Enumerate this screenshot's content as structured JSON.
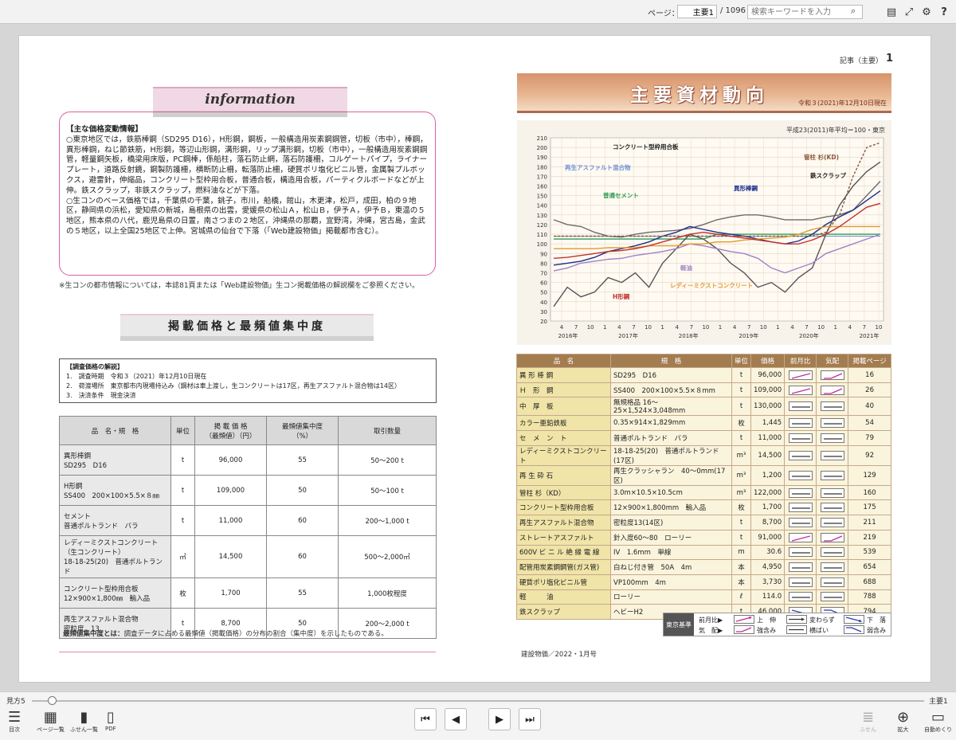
{
  "toolbar": {
    "page_label": "ページ：",
    "page_value": "主要1",
    "page_total": "/ 1096",
    "search_placeholder": "検索キーワードを入力"
  },
  "bottom": {
    "view_label": "見方5",
    "page_name": "主要1",
    "items": [
      "目次",
      "ページ一覧",
      "ふせん一覧",
      "PDF"
    ],
    "right_items": [
      "ふせん",
      "拡大",
      "自動めくり"
    ]
  },
  "right_page": {
    "kicker": "記事（主要）",
    "page_num": "1",
    "header_title": "主要資材動向",
    "header_date": "令和３(2021)年12月10日現在",
    "footer": "建設物価／2022・1月号"
  },
  "left_page": {
    "info_title": "information",
    "info_head": "【主な価格変動情報】",
    "info_p1": "○東京地区では，鉄筋棒鋼（SD295 D16），H形鋼，鋼板，一般構造用炭素鋼鋼管，切板（市中），棒鋼，異形棒鋼，ねじ節鉄筋，H形鋼，等辺山形鋼，溝形鋼，リップ溝形鋼，切板（市中），一般構造用炭素鋼鋼管，軽量鋼矢板，橋梁用床版，PC鋼棒，係船柱，落石防止網，落石防護柵，コルゲートパイプ，ライナープレート，道路反射鏡，鋼製防護柵，横断防止柵，転落防止柵，硬質ポリ塩化ビニル管，金属製プルボックス，避雷針，伸縮品，コンクリート型枠用合板，普通合板，構造用合板，パーティクルボードなどが上伸。鉄スクラップ，非鉄スクラップ，燃料油などが下落。",
    "info_p2": "○生コンのベース価格では，千葉県の千葉，銚子，市川，船橋，館山，木更津，松戸，成田，柏の９地区，静岡県の浜松，愛知県の新城，島根県の出雲，愛媛県の松山Ａ，松山Ｂ，伊予Ａ，伊予Ｂ，東温の５地区，熊本県の八代，鹿児島県の日置，南さつまの２地区，沖縄県の那覇，宜野湾，沖縄，宮古島，金武の５地区，以上全国25地区で上伸。宮城県の仙台で下落（「Web建設物価」掲載都市含む）。",
    "note1": "※生コンの都市情報については，本誌81頁または「Web建設物価」生コン掲載価格の解説欄をご参照ください。",
    "sec2_title": "掲載価格と最頻値集中度",
    "survey_head": "【調査価格の解説】",
    "survey": [
      "1.　調査時期　令和３（2021）年12月10日現在",
      "2.　荷渡場所　東京都市内現場持込み（鋼材は車上渡し，生コンクリートは17区，再生アスファルト混合物は14区）",
      "3.　決済条件　現金決済"
    ],
    "table_headers": [
      "品　名・規　格",
      "単位",
      "掲 載 価 格\n（最頻値）（円）",
      "最頻値集中度\n（%）",
      "取引数量"
    ],
    "table_rows": [
      [
        "異形棒鋼\nSD295　D16",
        "t",
        "96,000",
        "55",
        "50〜200 t"
      ],
      [
        "H形鋼\nSS400　200×100×5.5×８㎜",
        "t",
        "109,000",
        "50",
        "50〜100 t"
      ],
      [
        "セメント\n普通ポルトランド　バラ",
        "t",
        "11,000",
        "60",
        "200〜1,000 t"
      ],
      [
        "レディーミクストコンクリート\n（生コンクリート）\n18-18-25(20)　普通ポルトランド",
        "㎥",
        "14,500",
        "60",
        "500〜2,000㎥"
      ],
      [
        "コンクリート型枠用合板\n12×900×1,800㎜　輸入品",
        "枚",
        "1,700",
        "55",
        "1,000枚程度"
      ],
      [
        "再生アスファルト混合物\n密粒度　13",
        "t",
        "8,700",
        "50",
        "200〜2,000 t"
      ]
    ],
    "footnote_bold": "最頻値集中度とは：",
    "footnote": "調査データに占める最頻値（掲載価格）の分布の割合（集中度）を示したものである。"
  },
  "chart_data": {
    "type": "line",
    "note": "平成23(2011)年平均＝100・東京",
    "ylim": [
      20,
      210
    ],
    "yticks": [
      20,
      30,
      40,
      50,
      60,
      70,
      80,
      90,
      100,
      110,
      120,
      130,
      140,
      150,
      160,
      170,
      180,
      190,
      200,
      210
    ],
    "xtick_labels": [
      "4",
      "7",
      "10",
      "1",
      "4",
      "7",
      "10",
      "1",
      "4",
      "7",
      "10",
      "1",
      "4",
      "7",
      "10",
      "1",
      "4",
      "7",
      "10",
      "1",
      "4",
      "7",
      "10"
    ],
    "year_labels": [
      "2016年",
      "2017年",
      "2018年",
      "2019年",
      "2020年",
      "2021年"
    ],
    "series": [
      {
        "name": "コンクリート型枠用合板",
        "color": "#6b6b6b",
        "values": [
          125,
          120,
          118,
          112,
          108,
          107,
          110,
          112,
          113,
          114,
          116,
          120,
          125,
          128,
          130,
          130,
          128,
          125,
          125,
          125,
          128,
          130,
          135,
          150,
          165
        ]
      },
      {
        "name": "再生アスファルト混合物",
        "color": "#6f8fd8",
        "values": [
          108,
          108,
          108,
          108,
          108,
          108,
          108,
          108,
          108,
          108,
          108,
          108,
          108,
          108,
          108,
          108,
          108,
          108,
          108,
          108,
          108,
          108,
          108,
          108,
          108
        ]
      },
      {
        "name": "普通セメント",
        "color": "#2f9b55",
        "values": [
          105,
          105,
          105,
          105,
          105,
          105,
          105,
          105,
          105,
          105,
          105,
          105,
          110,
          110,
          110,
          110,
          110,
          110,
          110,
          110,
          110,
          110,
          110,
          110,
          110
        ]
      },
      {
        "name": "異形棒鋼",
        "color": "#1c2d8f",
        "values": [
          78,
          80,
          82,
          86,
          92,
          95,
          98,
          102,
          108,
          112,
          118,
          115,
          112,
          110,
          108,
          105,
          102,
          100,
          103,
          110,
          120,
          128,
          135,
          145,
          155
        ]
      },
      {
        "name": "管柱 杉(KD)",
        "color": "#8b5a3c",
        "values": [
          108,
          108,
          108,
          108,
          108,
          108,
          108,
          108,
          108,
          108,
          108,
          108,
          108,
          108,
          108,
          108,
          108,
          108,
          108,
          108,
          112,
          130,
          170,
          200,
          205
        ]
      },
      {
        "name": "鉄スクラップ",
        "color": "#555555",
        "values": [
          35,
          55,
          45,
          50,
          65,
          60,
          70,
          55,
          80,
          95,
          110,
          105,
          95,
          80,
          70,
          55,
          60,
          50,
          65,
          75,
          110,
          140,
          160,
          175,
          185
        ]
      },
      {
        "name": "軽油",
        "color": "#a081c9",
        "values": [
          72,
          75,
          80,
          82,
          84,
          85,
          88,
          90,
          92,
          95,
          100,
          98,
          95,
          92,
          90,
          85,
          75,
          70,
          75,
          80,
          90,
          95,
          100,
          105,
          110
        ]
      },
      {
        "name": "レディーミクストコンクリート",
        "color": "#e39a2e",
        "values": [
          95,
          95,
          95,
          95,
          96,
          96,
          96,
          98,
          98,
          98,
          100,
          100,
          102,
          102,
          104,
          105,
          106,
          107,
          110,
          115,
          118,
          118,
          118,
          118,
          118
        ]
      },
      {
        "name": "H形鋼",
        "color": "#c2332f",
        "values": [
          85,
          86,
          88,
          90,
          92,
          93,
          95,
          98,
          102,
          106,
          110,
          112,
          110,
          108,
          106,
          104,
          102,
          100,
          100,
          104,
          110,
          118,
          128,
          138,
          142
        ]
      }
    ]
  },
  "right_table": {
    "headers": [
      "品　名",
      "規　格",
      "単位",
      "価格",
      "前月比",
      "気配",
      "掲載ページ"
    ],
    "rows": [
      [
        "異 形 棒 鋼",
        "SD295　D16",
        "t",
        "96,000",
        "up",
        "up",
        "16"
      ],
      [
        "Ｈ　形　鋼",
        "SS400　200×100×5.5×８mm",
        "t",
        "109,000",
        "up",
        "up",
        "26"
      ],
      [
        "中　厚　板",
        "無規格品 16〜25×1,524×3,048mm",
        "t",
        "130,000",
        "flat",
        "flat",
        "40"
      ],
      [
        "カラー亜鉛鉄板",
        "0.35×914×1,829mm",
        "枚",
        "1,445",
        "flat",
        "flat",
        "54"
      ],
      [
        "セ　メ　ン　ト",
        "普通ポルトランド　バラ",
        "t",
        "11,000",
        "flat",
        "flat",
        "79"
      ],
      [
        "レディーミクストコンクリート",
        "18-18-25(20)　普通ポルトランド(17区)",
        "m³",
        "14,500",
        "flat",
        "flat",
        "92"
      ],
      [
        "再 生 砕 石",
        "再生クラッシャラン　40〜0mm(17区)",
        "m³",
        "1,200",
        "flat",
        "flat",
        "129"
      ],
      [
        "管柱 杉（KD）",
        "3.0m×10.5×10.5cm",
        "m³",
        "122,000",
        "flat",
        "flat",
        "160"
      ],
      [
        "コンクリート型枠用合板",
        "12×900×1,800mm　輸入品",
        "枚",
        "1,700",
        "flat",
        "flat",
        "175"
      ],
      [
        "再生アスファルト混合物",
        "密粒度13(14区)",
        "t",
        "8,700",
        "flat",
        "flat",
        "211"
      ],
      [
        "ストレートアスファルト",
        "針入度60〜80　ローリー",
        "t",
        "91,000",
        "up",
        "up",
        "219"
      ],
      [
        "600V ビ ニ ル 絶 縁 電 線",
        "IV　1.6mm　単線",
        "m",
        "30.6",
        "flat",
        "flat",
        "539"
      ],
      [
        "配管用炭素鋼鋼管(ガス管)",
        "白ねじ付き管　50A　4m",
        "本",
        "4,950",
        "flat",
        "flat",
        "654"
      ],
      [
        "硬質ポリ塩化ビニル管",
        "VP100mm　4m",
        "本",
        "3,730",
        "flat",
        "flat",
        "688"
      ],
      [
        "軽　　　油",
        "ローリー",
        "ℓ",
        "114.0",
        "flat",
        "flat",
        "788"
      ],
      [
        "鉄スクラップ",
        "ヘビーH2",
        "t",
        "46,000",
        "down",
        "down",
        "794"
      ]
    ],
    "legend": {
      "tag": "東京基準",
      "row1_label": "前月比▶",
      "row2_label": "気　配▶",
      "up": "上　伸",
      "flat": "変わらず",
      "down": "下　落",
      "up2": "強含み",
      "flat2": "横ばい",
      "down2": "弱含み"
    }
  }
}
